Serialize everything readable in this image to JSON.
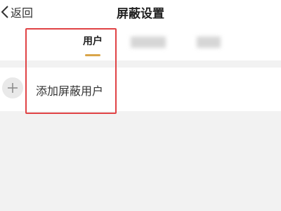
{
  "header": {
    "back_label": "返回",
    "title": "屏蔽设置"
  },
  "tabs": [
    {
      "label": "用户",
      "active": true
    }
  ],
  "add_row": {
    "label": "添加屏蔽用户"
  },
  "colors": {
    "accent_underline": "#d9a54a",
    "highlight_border": "#e04345",
    "background": "#f2f2f2"
  },
  "icons": {
    "back": "chevron-left-icon",
    "add": "plus-icon"
  }
}
